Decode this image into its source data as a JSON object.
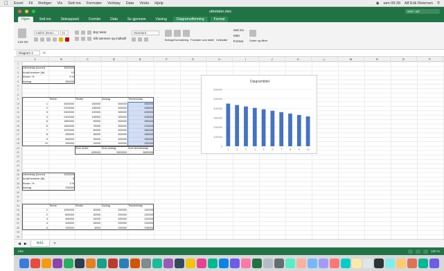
{
  "menubar": {
    "app": "Excel",
    "items": [
      "Fil",
      "Rediger",
      "Vis",
      "Sett inn",
      "Formater",
      "Verktøy",
      "Data",
      "Vindu",
      "Hjelp"
    ],
    "right_time": "søn 09:39",
    "right_user": "Alf Erik Reiersen"
  },
  "window": {
    "title": "utbetaler.xlsx",
    "search_placeholder": "Søk i ark"
  },
  "ribbon_tabs": [
    {
      "label": "Hjem",
      "active": true
    },
    {
      "label": "Sett inn",
      "active": false
    },
    {
      "label": "Sideoppsett",
      "active": false
    },
    {
      "label": "Formler",
      "active": false
    },
    {
      "label": "Data",
      "active": false
    },
    {
      "label": "Se gjennom",
      "active": false
    },
    {
      "label": "Visning",
      "active": false
    },
    {
      "label": "Diagramutforming",
      "active": false
    },
    {
      "label": "Format",
      "active": false
    }
  ],
  "ribbon": {
    "font_name": "Calibri (Brød...",
    "font_size": "11",
    "paste_label": "Lim inn",
    "wrap_label": "Bryt tekst",
    "merge_label": "Slå sammen og midtstill",
    "number_format": "Standard",
    "cond_format": "Betinget formatering",
    "table_format": "Formater som tabell",
    "cell_styles": "Cellestiler",
    "insert": "Sett inn",
    "delete": "Slett",
    "format": "Format",
    "sort_filter": "Sorter og filtrer"
  },
  "formula_bar": {
    "name_box": "Diagram 1",
    "fx": "fx",
    "value": ""
  },
  "columns": [
    "A",
    "B",
    "C",
    "D",
    "E",
    "F",
    "G",
    "H",
    "I",
    "J",
    "K",
    "L",
    "M",
    "N",
    "O",
    "P"
  ],
  "rows": [
    "1",
    "2",
    "3",
    "4",
    "5",
    "6",
    "7",
    "8",
    "9",
    "10",
    "11",
    "12",
    "13",
    "14",
    "15",
    "16",
    "17",
    "18",
    "19",
    "20",
    "21",
    "22",
    "23",
    "24",
    "25",
    "26",
    "27",
    "28",
    "29",
    "30",
    "31",
    "32",
    "33",
    "34",
    "35",
    "36",
    "37",
    "38",
    "39",
    "40"
  ],
  "sheet": {
    "params_top": [
      {
        "label": "Lånebeløp (kroner)",
        "value": "3000000"
      },
      {
        "label": "Antall terminer (år)",
        "value": "10"
      },
      {
        "label": "Rente i %",
        "value": "5 %"
      },
      {
        "label": "Avdrag",
        "value": "300000"
      }
    ],
    "table1_headers": [
      "Termin",
      "Renter",
      "Avdrag",
      "Terminbeløp"
    ],
    "table1_rows": [
      [
        "1",
        "3000000",
        "150000",
        "300000",
        "450000"
      ],
      [
        "2",
        "2700000",
        "135000",
        "300000",
        "435000"
      ],
      [
        "3",
        "2400000",
        "120000",
        "300000",
        "420000"
      ],
      [
        "4",
        "2100000",
        "105000",
        "300000",
        "405000"
      ],
      [
        "5",
        "1800000",
        "90000",
        "300000",
        "390000"
      ],
      [
        "6",
        "1500000",
        "75000",
        "300000",
        "375000"
      ],
      [
        "7",
        "1200000",
        "60000",
        "300000",
        "360000"
      ],
      [
        "8",
        "900000",
        "45000",
        "300000",
        "345000"
      ],
      [
        "9",
        "600000",
        "30000",
        "300000",
        "330000"
      ],
      [
        "10",
        "300000",
        "15000",
        "300000",
        "315000"
      ]
    ],
    "table1_sum_headers": [
      "Sum renter",
      "Sum avdrag",
      "Sum terminbeløp"
    ],
    "table1_sums": [
      "825000",
      "3000000",
      "3825000"
    ],
    "params_bottom": [
      {
        "label": "Lånebeløp (kroner)",
        "value": "1000000"
      },
      {
        "label": "Antall terminer (år)",
        "value": "5"
      },
      {
        "label": "Rente i %",
        "value": "4 %"
      },
      {
        "label": "Avdrag",
        "value": "200000"
      }
    ],
    "table2_headers": [
      "Termin",
      "Renter",
      "Avdrag",
      "Terminbeløp"
    ],
    "table2_rows": [
      [
        "1",
        "1000000",
        "40000",
        "200000",
        "240000"
      ],
      [
        "2",
        "800000",
        "32000",
        "200000",
        "232000"
      ],
      [
        "3",
        "600000",
        "24000",
        "200000",
        "224000"
      ],
      [
        "4",
        "400000",
        "16000",
        "200000",
        "216000"
      ],
      [
        "5",
        "200000",
        "8000",
        "200000",
        "208000"
      ]
    ]
  },
  "chart_data": {
    "type": "bar",
    "title": "Diagramtittel",
    "categories": [
      "1",
      "2",
      "3",
      "4",
      "5",
      "6",
      "7",
      "8",
      "9",
      "10"
    ],
    "series": [
      {
        "values": [
          450000,
          435000,
          420000,
          405000,
          390000,
          375000,
          360000,
          345000,
          330000,
          315000
        ]
      }
    ],
    "ylim": [
      0,
      600000
    ],
    "yticks": [
      "0",
      "100000",
      "200000",
      "300000",
      "400000",
      "500000",
      "600000"
    ],
    "bar_color": "#4472c4",
    "grid": true,
    "legend": "none"
  },
  "sheet_tabs": [
    {
      "label": "Ark1",
      "active": true
    }
  ],
  "add_sheet": "+",
  "status": {
    "ready": "Klar",
    "zoom": "100 %"
  },
  "colors": {
    "excel_green": "#217346",
    "selection": "#4472c4"
  }
}
